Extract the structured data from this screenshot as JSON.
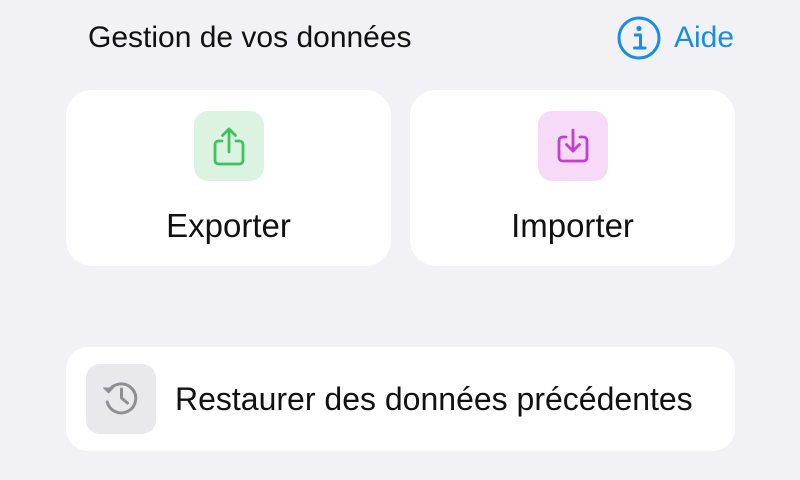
{
  "section": {
    "title": "Gestion de vos données"
  },
  "help": {
    "label": "Aide",
    "icon": "info-circle-icon",
    "color": "#1A8CE8"
  },
  "actions": [
    {
      "label": "Exporter",
      "icon": "share-export-icon",
      "icon_color": "#3CC25E",
      "tile_color": "#DDF3E2"
    },
    {
      "label": "Importer",
      "icon": "download-import-icon",
      "icon_color": "#C23FD6",
      "tile_color": "#F6DAF8"
    }
  ],
  "restore": {
    "label": "Restaurer des données précédentes",
    "icon": "history-clock-icon",
    "icon_color": "#8E8E93",
    "tile_color": "#E9E9EB"
  },
  "colors": {
    "background": "#F1F1F6",
    "card": "#FFFFFF",
    "text": "#111111"
  }
}
